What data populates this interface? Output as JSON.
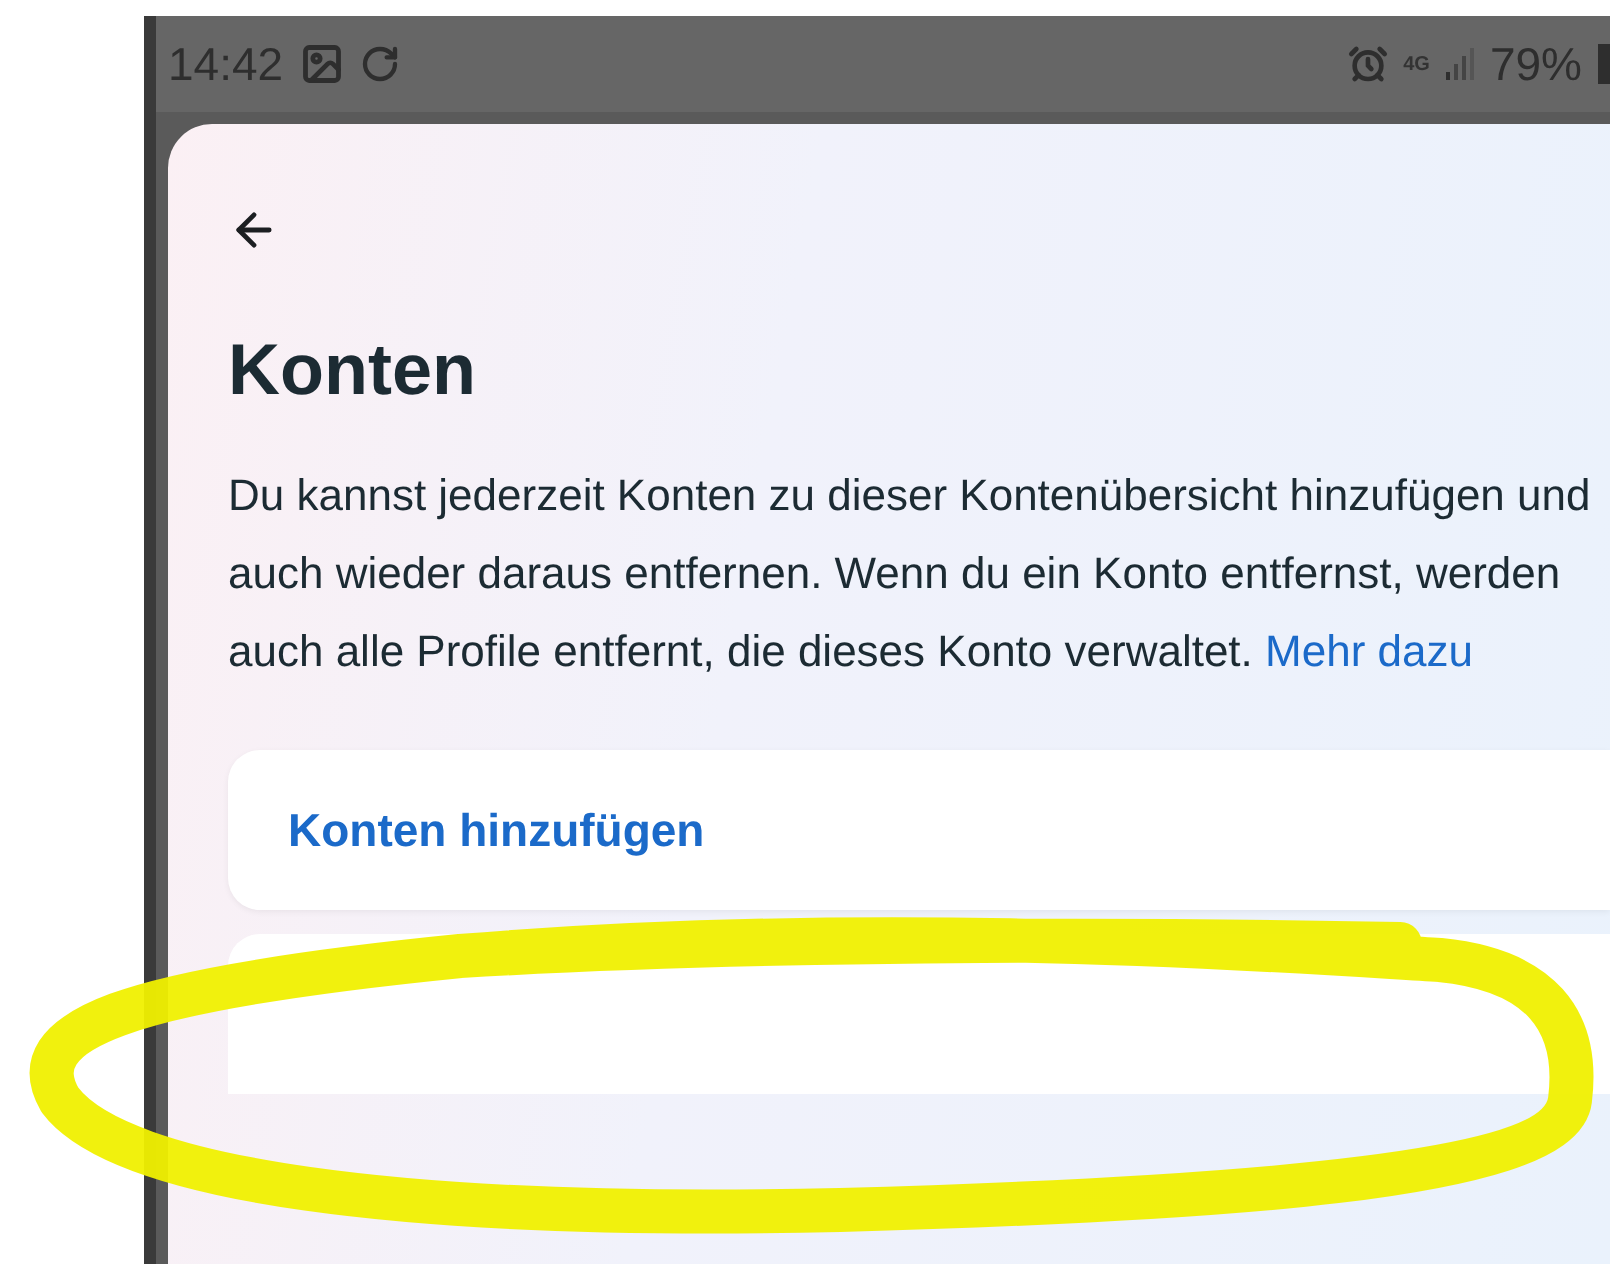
{
  "status_bar": {
    "time": "14:42",
    "network": "4G",
    "battery": "79%"
  },
  "screen": {
    "title": "Konten",
    "description": "Du kannst jederzeit Konten zu dieser Kontenübersicht hinzufügen und auch wieder daraus entfernen. Wenn du ein Konto entfernst, werden auch alle Profile entfernt, die dieses Konto verwaltet.",
    "link": "Mehr dazu"
  },
  "actions": [
    {
      "label": "Konten hinzufügen"
    }
  ]
}
